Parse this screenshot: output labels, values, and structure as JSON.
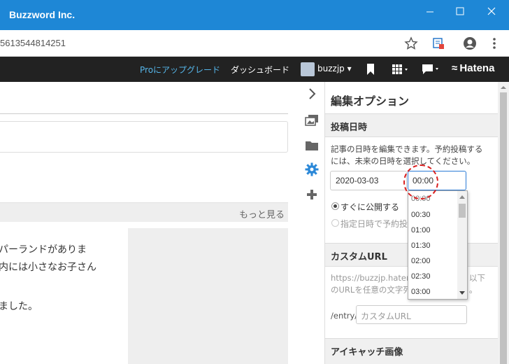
{
  "window": {
    "title": "Buzzword Inc.",
    "minimize_icon": "minimize-icon",
    "maximize_icon": "maximize-icon",
    "close_icon": "close-icon"
  },
  "address_bar": {
    "url": "5613544814251",
    "icons": [
      "star-icon",
      "extension-icon",
      "profile-icon",
      "menu-icon"
    ]
  },
  "hatena_bar": {
    "pro_link": "Proにアップグレード",
    "dashboard": "ダッシュボード",
    "username": "buzzjp",
    "logo": "Hatena",
    "colors": {
      "bar_bg": "#222222",
      "pro_link": "#56b6ea"
    }
  },
  "editor": {
    "more_link": "もっと見る",
    "article_lines": [
      "パーランドがありま",
      "内には小さなお子さん",
      "",
      "ました。"
    ]
  },
  "side_icons": [
    "chevron-right-icon",
    "images-icon",
    "folder-icon",
    "gear-icon",
    "plus-icon"
  ],
  "panel": {
    "title": "編集オプション",
    "post_date": {
      "heading": "投稿日時",
      "description_line1": "記事の日時を編集できます。予約投稿する",
      "description_line2": "には、未来の日時を選択してください。",
      "date_value": "2020-03-03",
      "time_value": "00:00",
      "radio_now": "すぐに公開する",
      "radio_scheduled": "指定日時で予約投"
    },
    "custom_url": {
      "heading": "カスタムURL",
      "description_line1": "https://buzzjp.hatena",
      "description_line1_tail": "以下",
      "description_line2": "のURLを任意の文字列",
      "description_line2_tail": "。",
      "prefix": "/entry/",
      "placeholder": "カスタムURL"
    },
    "eyecatch": {
      "heading": "アイキャッチ画像"
    },
    "accent": "#2b7bd6"
  },
  "time_dropdown": {
    "options": [
      "00:00",
      "00:30",
      "01:00",
      "01:30",
      "02:00",
      "02:30",
      "03:00"
    ]
  },
  "annotation": {
    "color": "#d91f1f"
  }
}
